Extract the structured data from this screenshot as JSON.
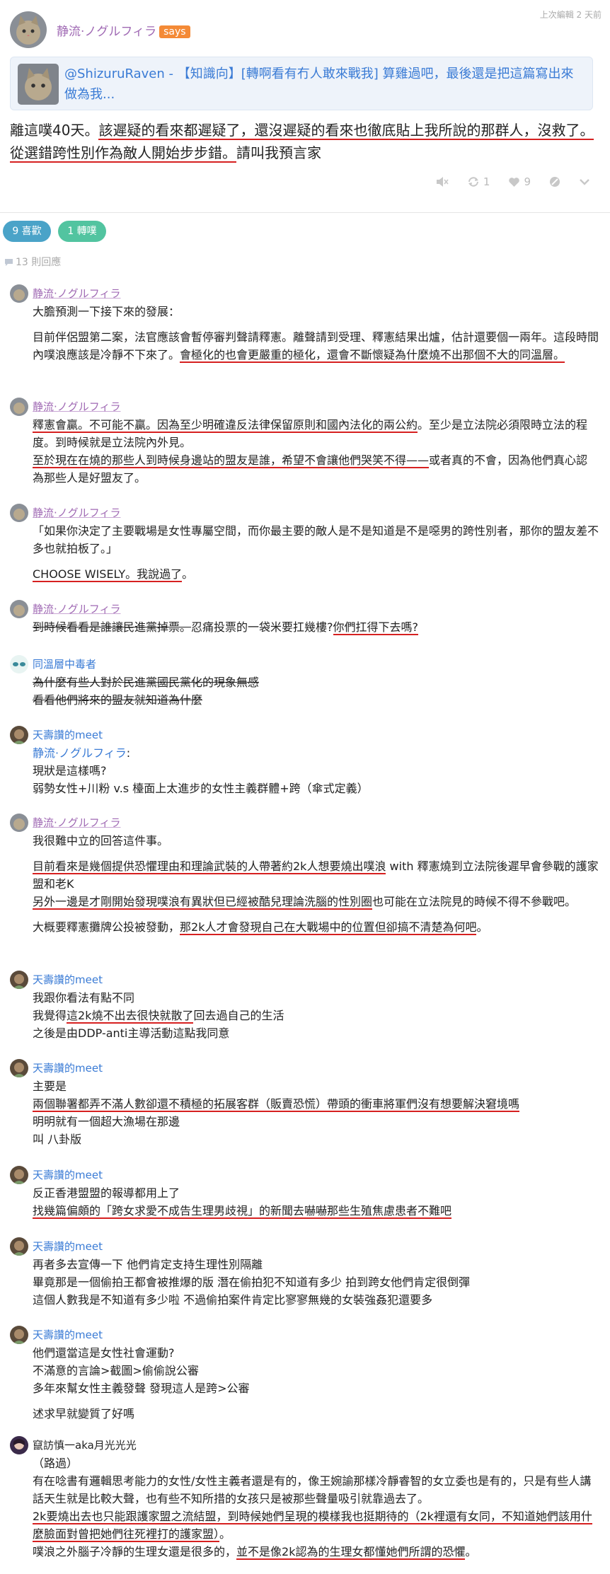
{
  "main": {
    "edited_label": "上次編輯 2 天前",
    "author": "静流·ノグルフィラ",
    "says": "says",
    "quote": "@ShizuruRaven - 【知識向】[轉啊看有冇人敢來戰我] 算雞過吧，最後還是把這篇寫出來做為我...",
    "text_a": "離這噗40天。",
    "text_b": "該遲疑的看來都遲疑了，還沒遲疑的看來也徹底貼上我所說的那群人，沒救了。",
    "text_c": "從選錯跨性別作為敵人開始步步錯。",
    "text_d": "請叫我預言家",
    "replurk_count": "1",
    "like_count": "9"
  },
  "badges": {
    "likes": "9 喜歡",
    "shares": "1 轉噗"
  },
  "response_count": "13 則回應",
  "responses": {
    "r1": {
      "name": "静流·ノグルフィラ",
      "l1": "大膽預測一下接下來的發展：",
      "l2": "目前伴侶盟第二案，法官應該會暫停審判聲請釋憲。離聲請到受理、釋憲結果出爐，估計還要個一兩年。這段時間內噗浪應該是冷靜不下來了。",
      "l2u": "會極化的也會更嚴重的極化，還會不斷懷疑為什麼燒不出那個不大的同溫層。"
    },
    "r2": {
      "name": "静流·ノグルフィラ",
      "a": "釋憲會贏。不可能不贏。因為至少明確違反法律保留原則和國內法化的兩公約",
      "b": "。至少是立法院必須限時立法的程度。到時候就是立法院內外見。",
      "c": "至於現在在燒的那些人到時候身邊站的盟友是誰，希望不會讓他們哭笑不得——",
      "d": "或者真的不會，因為他們真心認為那些人是好盟友了。"
    },
    "r3": {
      "name": "静流·ノグルフィラ",
      "a": "「如果你決定了主要戰場是女性專屬空間，而你最主要的敵人是不是知道是不是噁男的跨性別者，那你的盟友差不多也就拍板了。」",
      "b": "CHOOSE WISELY。我說過了",
      "c": "。"
    },
    "r4": {
      "name": "静流·ノグルフィラ",
      "a": "到時候看看是誰讓民進黨掉票。",
      "b": "忍痛投票的一袋米要扛幾樓?",
      "c": "你們扛得下去嗎?"
    },
    "r5": {
      "name": "同溫層中毒者",
      "a": "為什麼有些人對於民進黨國民黨化的現象無感",
      "b": "看看他們將來的盟友就知道為什麼"
    },
    "r6": {
      "name": "天壽讚的meet",
      "a": "静流·ノグルフィラ",
      "b": "現狀是這樣嗎?",
      "c": "弱勢女性+川粉 v.s 檯面上太進步的女性主義群體+跨（傘式定義）"
    },
    "r7": {
      "name": "静流·ノグルフィラ",
      "a": "我很難中立的回答這件事。",
      "b": "目前看來是幾個提供恐懼理由和理論武裝的人帶著約2k人想要燒出噗浪",
      "c": " with 釋憲燒到立法院後遲早會參戰的護家盟和老K",
      "d": "另外一邊是才剛開始發現噗浪有異狀但已經被酷兒理論洗腦的性別圈",
      "e": "也可能在立法院見的時候不得不參戰吧。",
      "f": "大概要釋憲攤牌公投被發動，",
      "g": "那2k人才會發現自己在大戰場中的位置但卻搞不清楚為何吧",
      "h": "。"
    },
    "r8": {
      "name": "天壽讚的meet",
      "a": "我跟你看法有點不同",
      "b1": "我覺得",
      "b2": "這2k燒不出去很快就散了",
      "b3": "回去過自己的生活",
      "c": "之後是由DDP-anti主導活動這點我同意"
    },
    "r9": {
      "name": "天壽讚的meet",
      "a": "主要是",
      "b": "兩個聯署都弄不滿人數卻還不積極的拓展客群（販賣恐慌）帶頭的衝車將軍們沒有想要解決窘境嗎",
      "c": "明明就有一個超大漁場在那邊",
      "d": "叫 八卦版"
    },
    "r10": {
      "name": "天壽讚的meet",
      "a": "反正香港盟盟的報導都用上了",
      "b": "找幾篇偏頗的「跨女求愛不成告生理男歧視」的新聞去嚇嚇那些生殖焦慮患者不難吧"
    },
    "r11": {
      "name": "天壽讚的meet",
      "a": "再者多去宣傳一下 他們肯定支持生理性別隔離",
      "b": "畢竟那是一個偷拍王都會被推爆的版 潛在偷拍犯不知道有多少 拍到跨女他們肯定很倒彈",
      "c": "這個人數我是不知道有多少啦 不過偷拍案件肯定比寥寥無幾的女裝強姦犯還要多"
    },
    "r12": {
      "name": "天壽讚的meet",
      "a": "他們還當這是女性社會運動?",
      "b": "不滿意的言論>截圖>偷偷說公審",
      "c": "多年來幫女性主義發聲 發現這人是跨>公審",
      "d": "述求早就變質了好嗎"
    },
    "r13": {
      "name": "竄訪慎一aka月光光光",
      "a": "（路過）",
      "b": "有在唸書有邏輯思考能力的女性/女性主義者還是有的，像王婉諭那樣冷靜睿智的女立委也是有的，只是有些人講話天生就是比較大聲，也有些不知所措的女孩只是被那些聲量吸引就靠過去了。",
      "c": "2k要燒出去也只能跟護家盟之流結盟，到時候她們呈現的模樣我也挺期待的（2k裡還有女同，不知道她們該用什麼臉面對曾把她們往死裡打的護家盟）",
      "d": "。",
      "e": "噗浪之外腦子冷靜的生理女還是很多的，",
      "f": "並不是像2k認為的生理女都懂她們所謂的恐懼",
      "g": "。"
    }
  }
}
